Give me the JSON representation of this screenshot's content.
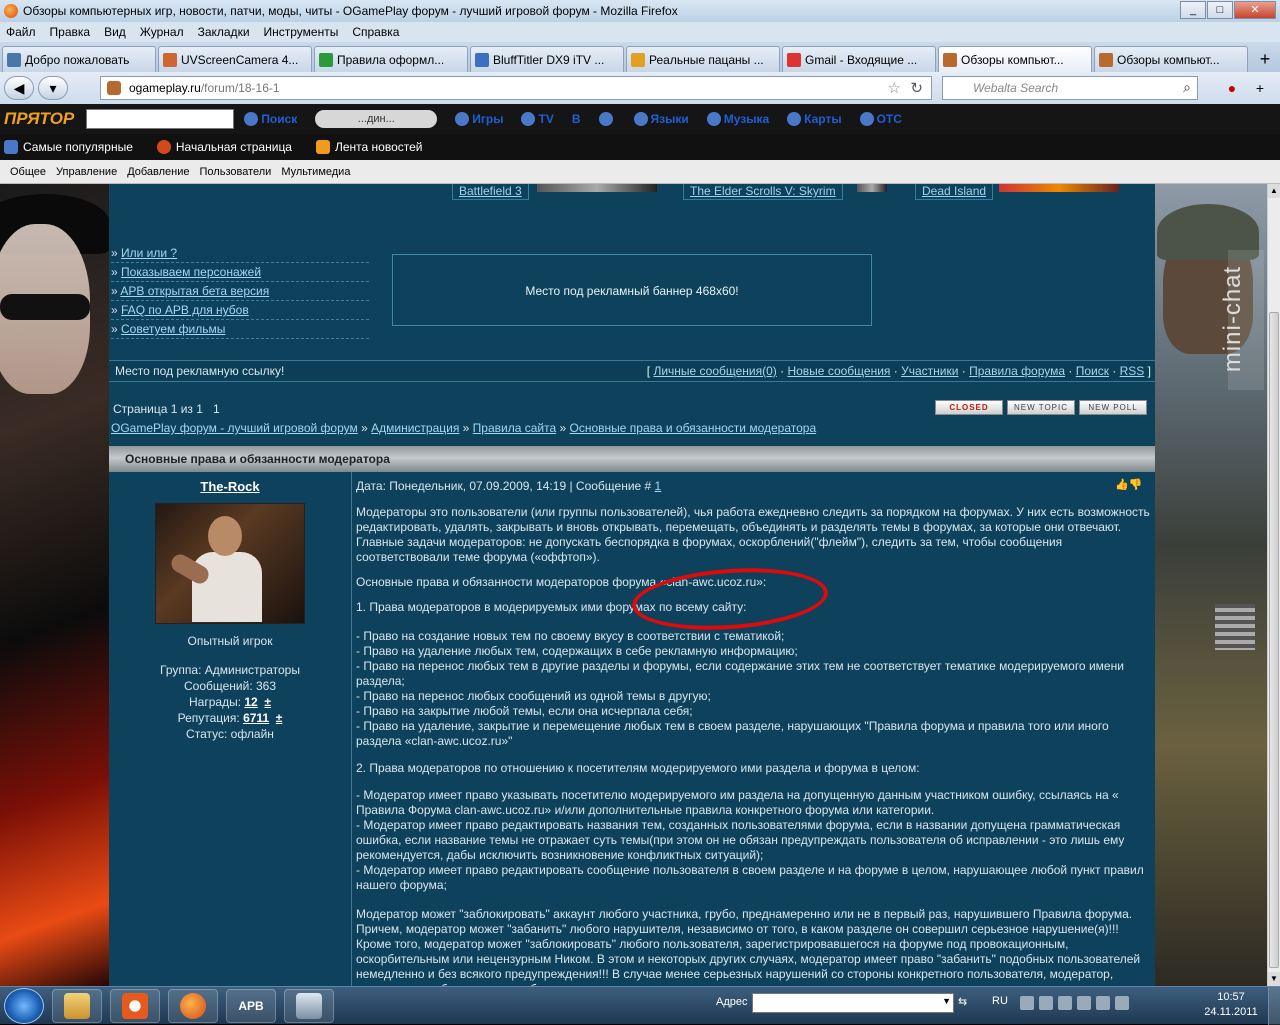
{
  "window": {
    "title": "Обзоры компьютерных игр, новости, патчи, моды, читы - OGamePlay форум - лучший игровой форум - Mozilla Firefox"
  },
  "menu": [
    "Файл",
    "Правка",
    "Вид",
    "Журнал",
    "Закладки",
    "Инструменты",
    "Справка"
  ],
  "tabs": [
    {
      "label": "Добро пожаловать",
      "color": "#4a76a8"
    },
    {
      "label": "UVScreenCamera 4...",
      "color": "#c63"
    },
    {
      "label": "Правила оформл...",
      "color": "#2b9b3a"
    },
    {
      "label": "BluffTitler DX9 iTV ...",
      "color": "#3c6fc0"
    },
    {
      "label": "Реальные пацаны ...",
      "color": "#e0a020"
    },
    {
      "label": "Gmail - Входящие ...",
      "color": "#d33"
    },
    {
      "label": "Обзоры компьют...",
      "color": "#b66a2e"
    },
    {
      "label": "Обзоры компьют...",
      "color": "#b66a2e"
    }
  ],
  "active_tab_index": 6,
  "address": {
    "domain": "ogameplay.ru",
    "path": "/forum/18-16-1"
  },
  "search": {
    "placeholder": "Webalta Search"
  },
  "toolbar2": {
    "logo": "ПРЯТОР",
    "search_btn": "Поиск",
    "radio": "...дин...",
    "links": [
      "Игры",
      "TV",
      "B",
      "Языки",
      "Музыка",
      "Карты",
      "ОТС"
    ]
  },
  "bookmarks": [
    "Самые популярные",
    "Начальная страница",
    "Лента новостей"
  ],
  "menu2": [
    "Общее",
    "Управление",
    "Добавление",
    "Пользователи",
    "Мультимедиа"
  ],
  "games": [
    "Battlefield 3",
    "The Elder Scrolls V: Skyrim",
    "Dead Island"
  ],
  "side_links": [
    "Или или ?",
    "Показываем персонажей",
    "APB открытая бета версия",
    "FAQ по APB для нубов",
    "Советуем фильмы"
  ],
  "banner": "Место под рекламный баннер 468x60!",
  "adbar": {
    "text": "Место под рекламную ссылку!",
    "nav": [
      "Личные сообщения(0)",
      "Новые сообщения",
      "Участники",
      "Правила форума",
      "Поиск",
      "RSS"
    ]
  },
  "pager": {
    "text": "Страница 1 из 1",
    "page": "1"
  },
  "buttons": {
    "closed": "CLOSED",
    "new_topic": "NEW TOPIC",
    "new_poll": "NEW POLL"
  },
  "breadcrumbs": [
    "OGamePlay форум - лучший игровой форум",
    "Администрация",
    "Правила сайта",
    "Основные права и обязанности модератора"
  ],
  "thread_title": "Основные права и обязанности модератора",
  "author": {
    "nick": "The-Rock",
    "role": "Опытный игрок",
    "group": "Группа: Администраторы",
    "posts": "Сообщений: 363",
    "awards_label": "Награды:",
    "awards": "12",
    "rep_label": "Репутация:",
    "rep": "6711",
    "status": "Статус: офлайн"
  },
  "post": {
    "date": "Дата: Понедельник, 07.09.2009, 14:19 | Сообщение # ",
    "num": "1",
    "p1": "Модераторы это пользователи (или группы пользователей), чья работа ежедневно следить за порядком на форумах. У них есть возможность редактировать, удалять, закрывать и вновь открывать, перемещать, объединять и разделять темы в форумах, за которые они отвечают. Главные задачи модераторов: не допускать беспорядка в форумах, оскорблений(\"флейм\"), следить за тем, чтобы сообщения соответствовали теме форума («оффтоп»).",
    "p2": "Основные права и обязанности модераторов форума «clan-awc.ucoz.ru»:",
    "p3": "1. Права модераторов в модерируемых ими форумах по всему сайту:",
    "l1": "- Право на создание новых тем по своему вкусу в соответствии с тематикой;",
    "l2": "- Право на удаление любых тем, содержащих в себе рекламную информацию;",
    "l3": "- Право на перенос любых тем в другие разделы и форумы, если содержание этих тем не соответствует тематике модерируемого имени раздела;",
    "l4": "- Право на перенос любых сообщений из одной темы в другую;",
    "l5": "- Право на закрытие любой темы, если она исчерпала себя;",
    "l6": "- Право на удаление, закрытие и перемещение любых тем в своем разделе, нарушающих \"Правила форума и правила того или иного раздела «clan-awc.ucoz.ru»\"",
    "p4": "2. Права модераторов по отношению к посетителям модерируемого ими раздела и форума в целом:",
    "m1": "- Модератор имеет право указывать посетителю модерируемого им раздела на допущенную данным участником ошибку, ссылаясь на « Правила Форума clan-awc.ucoz.ru» и/или дополнительные правила конкретного форума или категории.",
    "m2": "- Модератор имеет право редактировать названия тем, созданных пользователями форума, если в названии допущена грамматическая ошибка, если название темы не отражает суть темы(при этом он не обязан предупреждать пользователя об исправлении - это лишь ему рекомендуется, дабы исключить возникновение конфликтных ситуаций);",
    "m3": "- Модератор имеет право редактировать сообщение пользователя в своем разделе и на форуме в целом, нарушающее любой пункт правил нашего форума;",
    "p5": "Модератор может \"заблокировать\" аккаунт любого участника, грубо, преднамеренно или не в первый раз, нарушившего Правила форума. Причем, модератор может \"забанить\" любого нарушителя, независимо от того, в каком разделе он совершил серьезное нарушение(я)!!! Кроме того, модератор может \"заблокировать\" любого пользователя, зарегистрировавшегося на форуме под провокационным, оскорбительным или нецензурным Ником. В этом и некоторых других случаях, модератор имеет право \"забанить\" подобных пользователей немедленно и без всякого предупреждения!!! В случае менее серьезных нарушений со стороны конкретного пользователя, модератор, прежде, чем заблокировать любого нарушителя, должен сделать ему персональное предупреждение."
  },
  "minichat": "mini-chat",
  "taskbar": {
    "addr_label": "Адрес",
    "lang": "RU",
    "time": "10:57",
    "date": "24.11.2011",
    "apb": "APB"
  }
}
